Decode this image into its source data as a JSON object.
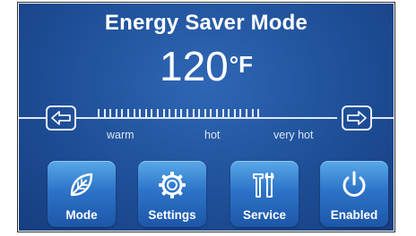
{
  "screen": {
    "title": "Energy Saver Mode",
    "temperature": {
      "value": "120",
      "unit": "°F"
    },
    "slider": {
      "labels": {
        "warm": "warm",
        "hot": "hot",
        "very_hot": "very hot"
      }
    },
    "buttons": [
      {
        "label": "Mode",
        "icon": "leaf-icon"
      },
      {
        "label": "Settings",
        "icon": "gear-icon"
      },
      {
        "label": "Service",
        "icon": "tools-icon"
      },
      {
        "label": "Enabled",
        "icon": "power-icon"
      }
    ]
  },
  "colors": {
    "background": "#1f4f98",
    "button": "#2d73c8",
    "text": "#ffffff"
  }
}
